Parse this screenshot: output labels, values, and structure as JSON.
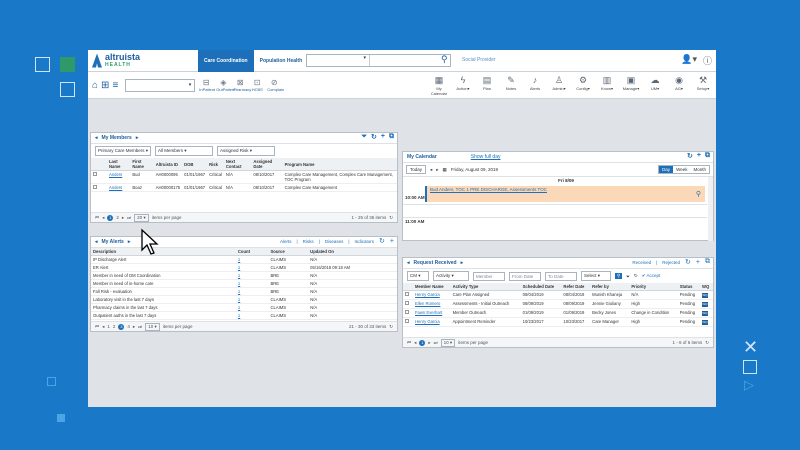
{
  "app": {
    "brand_top": "altruista",
    "brand_bottom": "HEALTH",
    "tabs": [
      "Care Coordination",
      "Population Health"
    ],
    "social_provider": "Social Provider",
    "search_placeholder": ""
  },
  "toolbar": {
    "left_apps": [
      {
        "label": "InPatient"
      },
      {
        "label": "OutPatient"
      },
      {
        "label": "Pharmacy"
      },
      {
        "label": "HCBS"
      },
      {
        "label": "Complain"
      }
    ],
    "right": [
      {
        "label": "My Calendar",
        "icon": "calendar-icon"
      },
      {
        "label": "Action",
        "icon": "bolt-icon"
      },
      {
        "label": "Plan",
        "icon": "doc-icon"
      },
      {
        "label": "Notes",
        "icon": "note-icon"
      },
      {
        "label": "Alerts",
        "icon": "bell-icon"
      },
      {
        "label": "Admin",
        "icon": "user-icon"
      },
      {
        "label": "Config",
        "icon": "gear-icon"
      },
      {
        "label": "Know",
        "icon": "book-icon"
      },
      {
        "label": "Manage",
        "icon": "manage-icon"
      },
      {
        "label": "UM",
        "icon": "um-icon"
      },
      {
        "label": "AG",
        "icon": "ag-icon"
      },
      {
        "label": "Setup",
        "icon": "setup-icon"
      }
    ]
  },
  "members": {
    "title": "My Members",
    "filters": [
      "Primary Care Members",
      "All Members",
      "Assigned Risk"
    ],
    "columns": [
      "Last Name",
      "First Name",
      "Altruista ID",
      "DOB",
      "Risk",
      "Next Contact",
      "Assigned Date",
      "Program Name"
    ],
    "rows": [
      [
        "Anders",
        "Bud",
        "AH0000095",
        "01/01/1967",
        "Critical",
        "N/A",
        "08/10/2017",
        "Complex Care Management, Complex Care Management, TOC Program"
      ],
      [
        "Anders",
        "Boaz",
        "AH00000175",
        "01/01/1967",
        "Critical",
        "N/A",
        "08/10/2017",
        "Complex Care Management"
      ]
    ],
    "page_size": "20",
    "items_label": "items per page",
    "count": "1 - 25 of 36 items"
  },
  "alerts": {
    "title": "My Alerts",
    "links": [
      "Alerts",
      "Risks",
      "Diseases",
      "Indicators"
    ],
    "columns": [
      "Description",
      "Count",
      "Source",
      "Updated On"
    ],
    "rows": [
      [
        "IP Discharge Alert",
        "1",
        "CLAIMS",
        "N/A"
      ],
      [
        "ER Alert",
        "1",
        "CLAIMS",
        "05/16/2018 09:18 AM"
      ],
      [
        "Member in need of DM Coordination",
        "1",
        "BRE",
        "N/A"
      ],
      [
        "Member in need of in-home care",
        "1",
        "BRE",
        "N/A"
      ],
      [
        "Fall Risk - evaluation",
        "1",
        "BRE",
        "N/A"
      ],
      [
        "Laboratory visit in the last 7 days",
        "1",
        "CLAIMS",
        "N/A"
      ],
      [
        "Pharmacy claims in the last 7 days",
        "1",
        "CLAIMS",
        "N/A"
      ],
      [
        "Outpatient auths in the last 7 days",
        "1",
        "CLAIMS",
        "N/A"
      ]
    ],
    "page_size": "10",
    "items_label": "items per page",
    "count": "21 - 30 of 33 items"
  },
  "calendar": {
    "title": "My Calendar",
    "show_full_day": "Show full day",
    "today": "Today",
    "date": "Friday, August 09, 2019",
    "views": [
      "Day",
      "Week",
      "Month"
    ],
    "day_header": "Fri 8/09",
    "event1": "Bud Anders, TOC 1 PRE DISCHARGE, Assessments TOC",
    "time1": "10:00 AM",
    "time2": "11:00 AM"
  },
  "requests": {
    "title": "Request Received",
    "links": [
      "Received",
      "Rejected"
    ],
    "filters": [
      "CM",
      "Activity",
      "Member",
      "From Date",
      "To Date",
      "Select"
    ],
    "accept": "Accept",
    "columns": [
      "Member Name",
      "Activity Type",
      "Scheduled Date",
      "Refer Date",
      "Refer by",
      "Priority",
      "Status",
      "WQ"
    ],
    "rows": [
      [
        "Henry Garcia",
        "Care Plan Assigned",
        "08/04/2019",
        "08/04/2019",
        "Munish Khaneja",
        "N/A",
        "Pending"
      ],
      [
        "Ellen Romero",
        "Assessments - Initial Outreach",
        "08/09/2019",
        "08/09/2019",
        "Jennie Giuliany",
        "High",
        "Pending"
      ],
      [
        "Fawn Everhart",
        "Member Outreach",
        "01/09/2019",
        "01/09/2019",
        "Becky Jones",
        "Change in Condition",
        "Pending"
      ],
      [
        "Henry Garcia",
        "Appointment Reminder",
        "10/23/2017",
        "10/23/2017",
        "Care Manager",
        "High",
        "Pending"
      ]
    ],
    "page_size": "10",
    "items_label": "items per page",
    "count": "1 - 6 of 6 items"
  }
}
